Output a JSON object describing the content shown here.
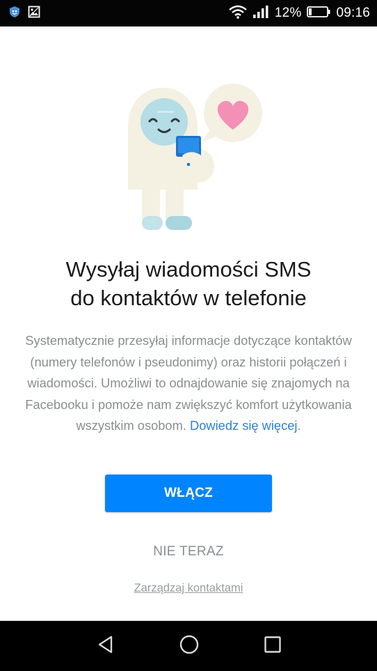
{
  "status_bar": {
    "battery_percent": "12%",
    "time": "09:16",
    "battery_level": 0.12,
    "icons": [
      "shield-notification-icon",
      "image-notification-icon",
      "wifi-icon",
      "signal-icon",
      "battery-icon"
    ]
  },
  "headline": {
    "line1": "Wysyłaj wiadomości SMS",
    "line2": "do kontaktów w telefonie"
  },
  "body": {
    "text": "Systematycznie przesyłaj informacje dotyczące kontaktów (numery telefonów i pseudonimy) oraz historii połączeń i wiadomości. Umożliwi to odnajdowanie się znajomych na Facebooku i pomoże nam zwiększyć komfort użytkowania wszystkim osobom.",
    "link_label": "Dowiedz się więcej",
    "trailing": "."
  },
  "buttons": {
    "enable_label": "WŁĄCZ",
    "not_now_label": "NIE TERAZ",
    "manage_contacts_label": "Zarządzaj kontaktami"
  },
  "navigation": {
    "icons": [
      "back-icon",
      "home-icon",
      "recents-icon"
    ]
  },
  "colors": {
    "primary": "#0084ff",
    "link": "#2d7fd6",
    "heart": "#f48fb1",
    "status_bar": "#050505",
    "nav_bar": "#000000"
  }
}
